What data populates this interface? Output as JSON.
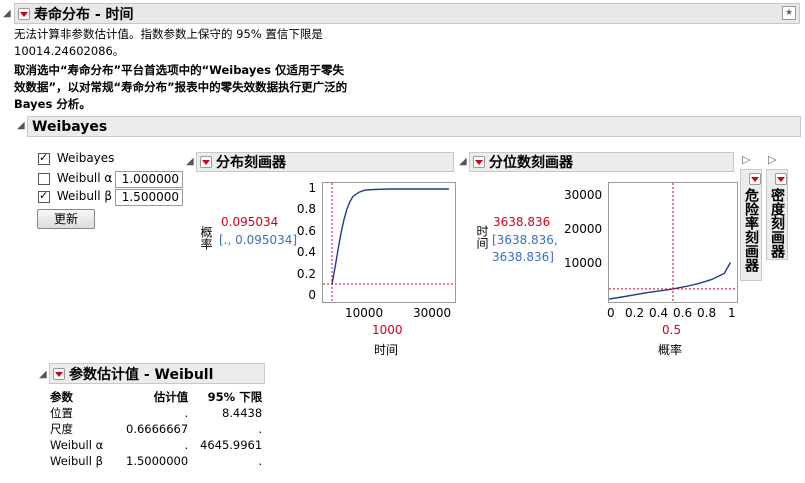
{
  "main": {
    "title": "寿命分布 - 时间",
    "message_line1": "无法计算非参数估计值。指数参数上保守的 95% 置信下限是",
    "message_line2": "10014.24602086。",
    "bold_line1": "取消选中“寿命分布”平台首选项中的“Weibayes 仅适用于零失",
    "bold_line2": "效数据”，以对常规“寿命分布”报表中的零失效数据执行更广泛的",
    "bold_line3": "Bayes 分析。"
  },
  "weibayes": {
    "title": "Weibayes",
    "checkbox_weibayes": "Weibayes",
    "checkbox_alpha": "Weibull α",
    "checkbox_beta": "Weibull β",
    "alpha_value": "1.000000",
    "beta_value": "1.500000",
    "update_button": "更新"
  },
  "dist_profiler": {
    "title": "分布刻画器",
    "y_axis_label": "概率",
    "y_value": "0.095034",
    "y_interval": "[., 0.095034]",
    "y_ticks": [
      "1",
      "0.8",
      "0.6",
      "0.4",
      "0.2",
      "0"
    ],
    "x_ticks": [
      "10000",
      "30000"
    ],
    "x_value": "1000",
    "x_axis_label": "时间"
  },
  "quant_profiler": {
    "title": "分位数刻画器",
    "y_axis_label": "时间",
    "y_value": "3638.836",
    "y_interval_line1": "[3638.836,",
    "y_interval_line2": "3638.836]",
    "y_ticks": [
      "30000",
      "20000",
      "10000"
    ],
    "x_ticks": [
      "0",
      "0.2",
      "0.4",
      "0.6",
      "0.8",
      "1"
    ],
    "x_value": "0.5",
    "x_axis_label": "概率"
  },
  "collapsed": {
    "hazard_title": "危险率刻画器",
    "density_title": "密度刻画器"
  },
  "param_table": {
    "title": "参数估计值 - Weibull",
    "headers": [
      "参数",
      "估计值",
      "95% 下限"
    ],
    "rows": [
      [
        "位置",
        ".",
        "8.4438"
      ],
      [
        "尺度",
        "0.6666667",
        "."
      ],
      [
        "Weibull α",
        ".",
        "4645.9961"
      ],
      [
        "Weibull β",
        "1.5000000",
        "."
      ]
    ]
  },
  "chart_data": [
    {
      "type": "line",
      "title": "分布刻画器",
      "xlabel": "时间",
      "ylabel": "概率",
      "xlim": [
        -2000,
        42000
      ],
      "ylim": [
        0,
        1
      ],
      "x": [
        1000,
        2000,
        3000,
        4000,
        5000,
        6000,
        7000,
        8000,
        10000,
        12000,
        15000,
        20000,
        30000,
        40000
      ],
      "series": [
        {
          "values": [
            0.095,
            0.25,
            0.42,
            0.58,
            0.71,
            0.81,
            0.88,
            0.93,
            0.97,
            0.99,
            0.995,
            1.0,
            1.0,
            1.0
          ]
        }
      ],
      "crosshair": {
        "x": 1000,
        "y": 0.095034
      }
    },
    {
      "type": "line",
      "title": "分位数刻画器",
      "xlabel": "概率",
      "ylabel": "时间",
      "xlim": [
        0,
        1
      ],
      "ylim": [
        0,
        33000
      ],
      "x": [
        0.0,
        0.1,
        0.2,
        0.3,
        0.4,
        0.5,
        0.6,
        0.7,
        0.8,
        0.9,
        0.95
      ],
      "series": [
        {
          "values": [
            800,
            1400,
            2000,
            2600,
            3100,
            3639,
            4300,
            5100,
            6200,
            7900,
            11000
          ]
        }
      ],
      "crosshair": {
        "x": 0.5,
        "y": 3638.836
      }
    }
  ]
}
